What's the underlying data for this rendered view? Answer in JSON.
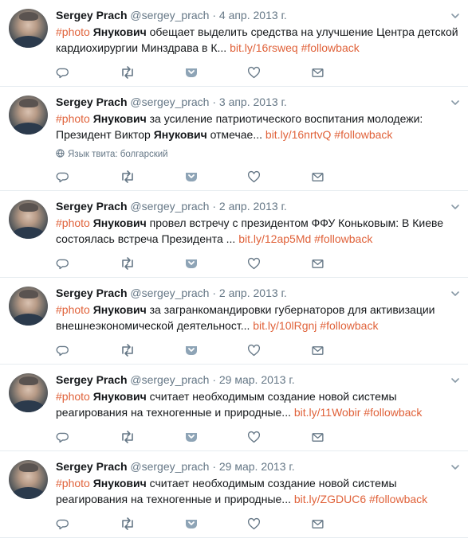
{
  "author": {
    "name": "Sergey Prach",
    "handle": "@sergey_prach"
  },
  "separator": "·",
  "tweets": [
    {
      "date": "4 апр. 2013 г.",
      "hashtag": "#photo",
      "bold": "Янукович",
      "text": "обещает выделить средства на улучшение Центра детской кардиохирургии Минздрава в К...",
      "link": "bit.ly/16rsweq",
      "tag2": "#followback",
      "lang_note": ""
    },
    {
      "date": "3 апр. 2013 г.",
      "hashtag": "#photo",
      "bold": "Янукович",
      "text": "за усиление патриотического воспитания молодежи: Президент Виктор",
      "bold2": "Янукович",
      "text2": "отмечае...",
      "link": "bit.ly/16nrtvQ",
      "tag2": "#followback",
      "lang_note": "Язык твита: болгарский"
    },
    {
      "date": "2 апр. 2013 г.",
      "hashtag": "#photo",
      "bold": "Янукович",
      "text": "провел встречу с президентом ФФУ Коньковым: В Киеве состоялась встреча Президента ...",
      "link": "bit.ly/12ap5Md",
      "tag2": "#followback",
      "lang_note": ""
    },
    {
      "date": "2 апр. 2013 г.",
      "hashtag": "#photo",
      "bold": "Янукович",
      "text": "за загранкомандировки губернаторов для активизации внешнеэкономической деятельност...",
      "link": "bit.ly/10lRgnj",
      "tag2": "#followback",
      "lang_note": ""
    },
    {
      "date": "29 мар. 2013 г.",
      "hashtag": "#photo",
      "bold": "Янукович",
      "text": "считает необходимым создание новой системы реагирования на техногенные и природные...",
      "link": "bit.ly/11Wobir",
      "tag2": "#followback",
      "lang_note": ""
    },
    {
      "date": "29 мар. 2013 г.",
      "hashtag": "#photo",
      "bold": "Янукович",
      "text": "считает необходимым создание новой системы реагирования на техногенные и природные...",
      "link": "bit.ly/ZGDUC6",
      "tag2": "#followback",
      "lang_note": ""
    }
  ],
  "icons": [
    "reply-icon",
    "retweet-icon",
    "fave-bookmark-icon",
    "like-icon",
    "message-icon",
    "caret-icon",
    "globe-icon"
  ],
  "colors": {
    "link": "#e0623a",
    "meta": "#657786",
    "divider": "#e6ecf0"
  }
}
